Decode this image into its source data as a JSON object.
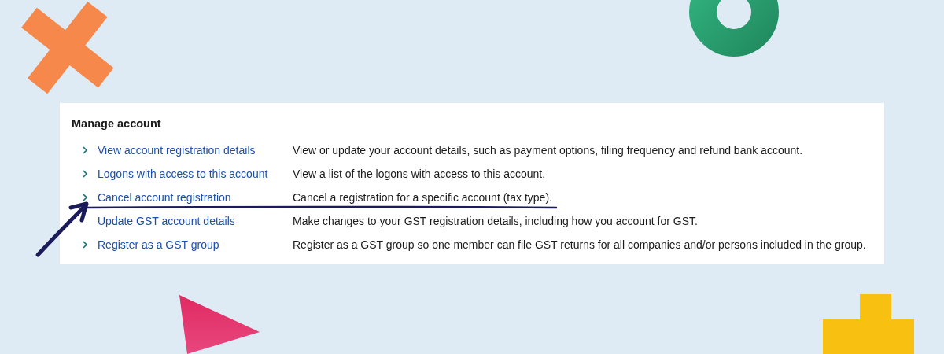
{
  "section": {
    "title": "Manage account",
    "items": [
      {
        "link": "View account registration details",
        "description": "View or update your account details, such as payment options, filing frequency and refund bank account.",
        "chevron": true
      },
      {
        "link": "Logons with access to this account",
        "description": "View a list of the logons with access to this account.",
        "chevron": true
      },
      {
        "link": "Cancel account registration",
        "description": "Cancel a registration for a specific account (tax type).",
        "chevron": true
      },
      {
        "link": "Update GST account details",
        "description": "Make changes to your GST registration details, including how you account for GST.",
        "chevron": false
      },
      {
        "link": "Register as a GST group",
        "description": "Register as a GST group so one member can file GST returns for all companies and/or persons included in the group.",
        "chevron": true
      }
    ]
  }
}
